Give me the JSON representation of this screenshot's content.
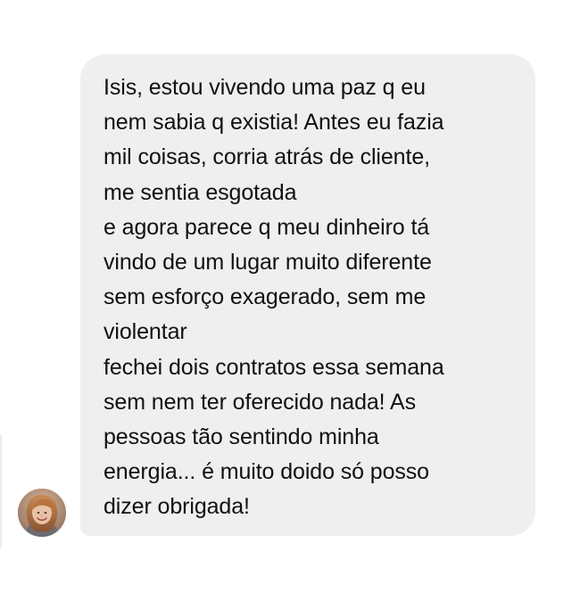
{
  "conversation": {
    "avatar_icon": "profile-photo-woman",
    "bubble_color": "#efefef",
    "text_color": "#111111",
    "message": {
      "lines": [
        "Isis, estou vivendo uma paz q eu",
        "nem sabia q existia! Antes eu fazia",
        "mil coisas, corria atrás de cliente,",
        "me sentia esgotada",
        "e agora parece q meu dinheiro tá",
        "vindo de um lugar muito diferente",
        "sem esforço exagerado, sem me",
        "violentar",
        "fechei dois contratos essa semana",
        "sem nem ter oferecido nada! As",
        "pessoas tão sentindo minha",
        "energia... é muito doido só posso",
        "dizer obrigada!"
      ]
    }
  }
}
